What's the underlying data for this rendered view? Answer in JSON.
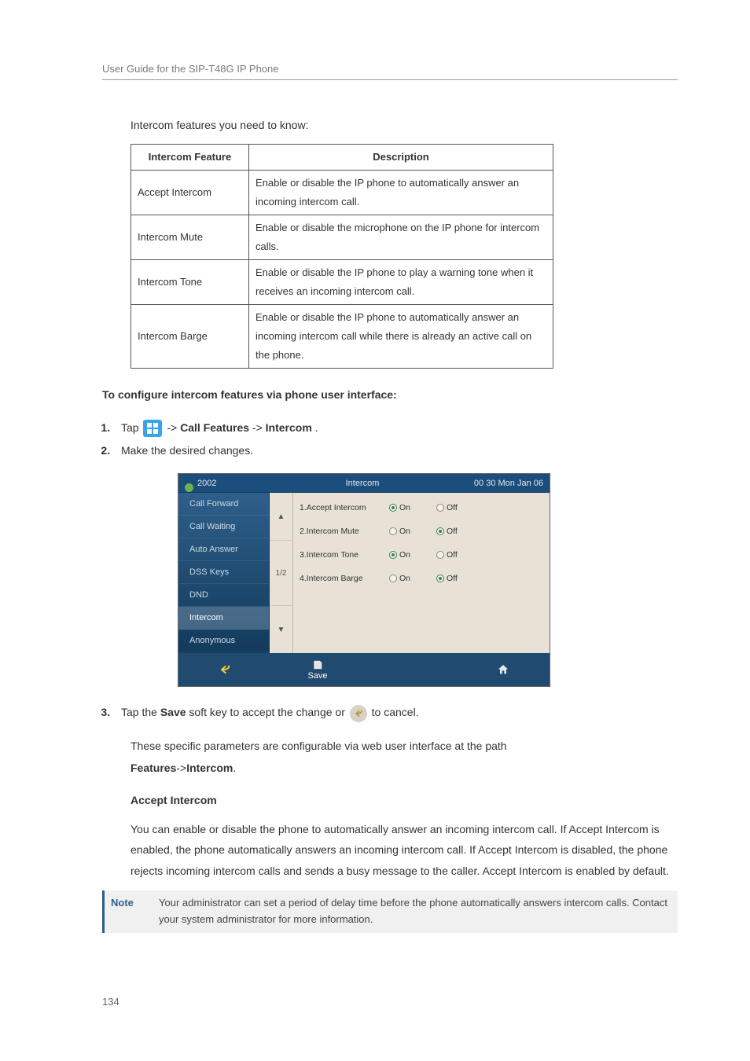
{
  "header": {
    "title": "User Guide for the SIP-T48G IP Phone"
  },
  "intro": "Intercom features you need to know:",
  "table": {
    "th1": "Intercom Feature",
    "th2": "Description",
    "rows": [
      {
        "feature": "Accept Intercom",
        "desc": "Enable or disable the IP phone to automatically answer an incoming intercom call."
      },
      {
        "feature": "Intercom Mute",
        "desc": "Enable or disable the microphone on the IP phone for intercom calls."
      },
      {
        "feature": "Intercom Tone",
        "desc": "Enable or disable the IP phone to play a warning tone when it receives an incoming intercom call."
      },
      {
        "feature": "Intercom Barge",
        "desc": "Enable or disable the IP phone to automatically answer an incoming intercom call while there is already an active call on the phone."
      }
    ]
  },
  "configure_heading": "To configure intercom features via phone user interface:",
  "steps": {
    "s1_pre": "Tap ",
    "s1_mid": " ->",
    "s1_b1": "Call Features",
    "s1_sep": "->",
    "s1_b2": "Intercom",
    "s1_end": ".",
    "s2": "Make the desired changes.",
    "s3_pre": "Tap the ",
    "s3_b": "Save",
    "s3_mid": " soft key to accept the change or ",
    "s3_end": " to cancel."
  },
  "screenshot": {
    "account": "2002",
    "title": "Intercom",
    "time": "00 30 Mon Jan 06",
    "side": [
      "Call Forward",
      "Call Waiting",
      "Auto Answer",
      "DSS Keys",
      "DND",
      "Intercom",
      "Anonymous"
    ],
    "active_index": 5,
    "scroll_mid": "1/2",
    "rows": [
      {
        "label": "1.Accept Intercom",
        "on": true
      },
      {
        "label": "2.Intercom Mute",
        "on": false
      },
      {
        "label": "3.Intercom Tone",
        "on": true
      },
      {
        "label": "4.Intercom Barge",
        "on": false
      }
    ],
    "on_label": "On",
    "off_label": "Off",
    "save_label": "Save"
  },
  "post_text_1": "These specific parameters are configurable via web user interface at the path",
  "post_text_b1": "Features",
  "post_text_sep": "->",
  "post_text_b2": "Intercom",
  "post_text_end": ".",
  "section_heading": "Accept Intercom",
  "section_body": "You can enable or disable the phone to automatically answer an incoming intercom call. If Accept Intercom is enabled, the phone automatically answers an incoming intercom call. If Accept Intercom is disabled, the phone rejects incoming intercom calls and sends a busy message to the caller. Accept Intercom is enabled by default.",
  "note": {
    "label": "Note",
    "body": "Your administrator can set a period of delay time before the phone automatically answers intercom calls. Contact your system administrator for more information."
  },
  "page_number": "134"
}
